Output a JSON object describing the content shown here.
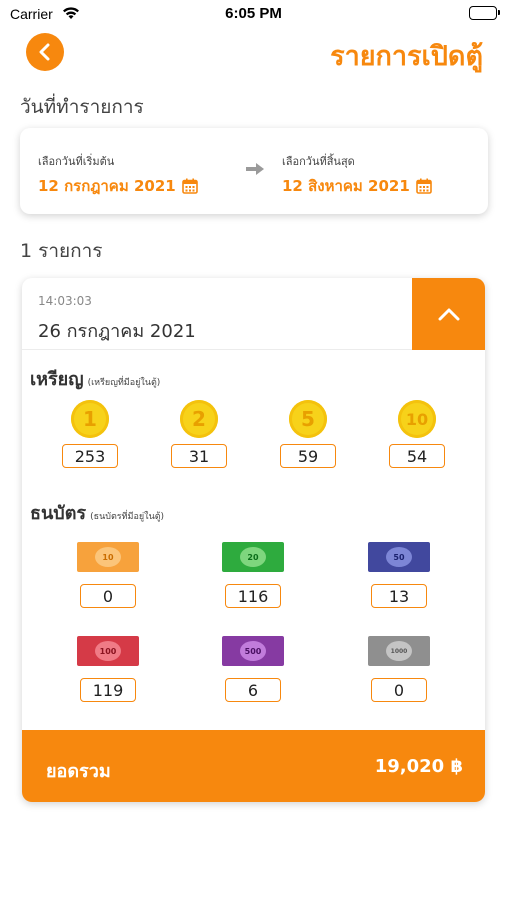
{
  "status": {
    "carrier": "Carrier",
    "time": "6:05 PM"
  },
  "header": {
    "title": "รายการเปิดตู้"
  },
  "date_range": {
    "section_label": "วันที่ทำรายการ",
    "start_caption": "เลือกวันที่เริ่มต้น",
    "start_value": "12 กรกฎาคม 2021",
    "end_caption": "เลือกวันที่สิ้นสุด",
    "end_value": "12 สิงหาคม 2021"
  },
  "result_count": "1 รายการ",
  "record": {
    "time": "14:03:03",
    "date": "26 กรกฎาคม 2021",
    "coins": {
      "title": "เหรียญ",
      "subtitle": "(เหรียญที่มีอยู่ในตู้)",
      "items": [
        {
          "denomination": "1",
          "count": "253"
        },
        {
          "denomination": "2",
          "count": "31"
        },
        {
          "denomination": "5",
          "count": "59"
        },
        {
          "denomination": "10",
          "count": "54"
        }
      ]
    },
    "banknotes": {
      "title": "ธนบัตร",
      "subtitle": "(ธนบัตรที่มีอยู่ในตู้)",
      "items": [
        {
          "denomination": "10",
          "count": "0"
        },
        {
          "denomination": "20",
          "count": "116"
        },
        {
          "denomination": "50",
          "count": "13"
        },
        {
          "denomination": "100",
          "count": "119"
        },
        {
          "denomination": "500",
          "count": "6"
        },
        {
          "denomination": "1000",
          "count": "0"
        }
      ]
    },
    "total_label": "ยอดรวม",
    "total_value": "19,020 ฿"
  },
  "colors": {
    "accent": "#f7880e",
    "coin": "#f7d21a"
  }
}
